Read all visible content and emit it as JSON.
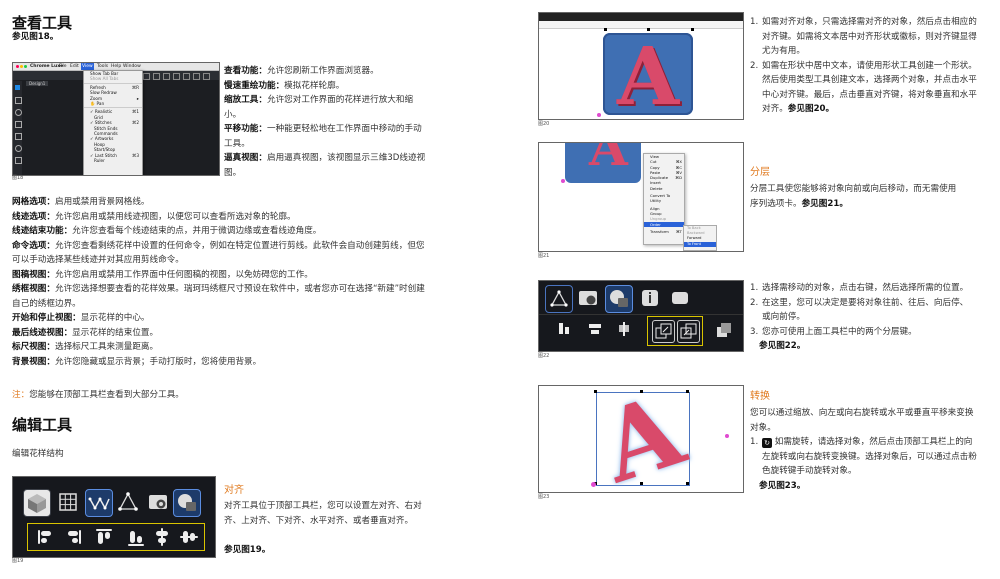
{
  "left": {
    "title_view": "查看工具",
    "see18": "参见图18。",
    "fig18": {
      "app_name": "Chrome Luxe",
      "menus": [
        "File",
        "Edit",
        "View",
        "Tools",
        "Help",
        "Window"
      ],
      "menu_items": [
        "Show Tab Bar",
        "Show All Tabs",
        "Refresh",
        "Slow Redraw",
        "Zoom",
        "Pan",
        "Realistic",
        "Grid",
        "Stitches",
        "Stitch Ends",
        "Commands",
        "Artworks",
        "Hoop",
        "Start/Stop",
        "Last Stitch",
        "Ruler"
      ],
      "shortcuts": [
        "⌘R",
        "⌘1",
        "⌘2",
        "⌘3"
      ],
      "design_tab": "Design1",
      "label": "图18"
    },
    "desc_top": [
      {
        "term": "查看功能：",
        "text": "允许您刷新工作界面浏览器。"
      },
      {
        "term": "慢速重绘功能：",
        "text": "模拟花样轮廓。"
      },
      {
        "term": "缩放工具：",
        "text": "允许您对工作界面的花样进行放大和缩小。"
      },
      {
        "term": "平移功能：",
        "text": "一种能更轻松地在工作界面中移动的手动工具。"
      },
      {
        "term": "逼真视图：",
        "text": "启用逼真视图，该视图显示三维3D线迹视图。"
      }
    ],
    "desc_list": [
      {
        "term": "网格选项：",
        "text": "启用或禁用背景网格线。"
      },
      {
        "term": "线迹选项：",
        "text": "允许您启用或禁用线迹视图，以便您可以查看所选对象的轮廓。"
      },
      {
        "term": "线迹结束功能：",
        "text": "允许您查看每个线迹结束的点，并用于微调边缘或查看线迹角度。"
      },
      {
        "term": "命令选项：",
        "text": "允许您查看剩绣花样中设置的任何命令，例如在特定位置进行剪线。此软件会自动创建剪线，但您可以手动选择某些线迹并对其应用剪线命令。"
      },
      {
        "term": "图稿视图：",
        "text": "允许您启用或禁用工作界面中任何图稿的视图，以免妨碍您的工作。"
      },
      {
        "term": "绣框视图：",
        "text": "允许您选择想要查看的花样效果。瑞珂玛绣框尺寸预设在软件中，或者您亦可在选择“新建”时创建自己的绣框边界。"
      },
      {
        "term": "开始和停止视图：",
        "text": "显示花样的中心。"
      },
      {
        "term": "最后线迹视图：",
        "text": "显示花样的结束位置。"
      },
      {
        "term": "标尺视图：",
        "text": "选择标尺工具来测量距离。"
      },
      {
        "term": "背景视图：",
        "text": "允许您隐藏或显示背景；手动打版时，您将使用背景。"
      }
    ],
    "note_label": "注：",
    "note_text": "您能够在顶部工具栏查看到大部分工具。",
    "title_edit": "编辑工具",
    "edit_sub": "编辑花样结构",
    "fig19": {
      "label": "图19"
    },
    "align_title": "对齐",
    "align_text": "对齐工具位于顶部工具栏，您可以设置左对齐、右对齐、上对齐、下对齐、水平对齐、或者垂直对齐。",
    "see19": "参见图19。"
  },
  "right": {
    "fig20": {
      "label": "图20",
      "letter": "A"
    },
    "align_steps": [
      "如需对齐对象，只需选择需对齐的对象，然后点击相应的对齐键。如需将文本居中对齐形状或徽标，则对齐键显得尤为有用。",
      "如需在形状中居中文本，请使用形状工具创建一个形状。然后使用类型工具创建文本，选择两个对象，并点击水平中心对齐键。最后，点击垂直对齐键，将对象垂直和水平对齐。"
    ],
    "see20": "参见图20。",
    "fig21": {
      "label": "图21",
      "menu_items": [
        "View",
        "Cut",
        "Copy",
        "Paste",
        "Duplicate",
        "Insert",
        "Delete",
        "Convert To",
        "Utility",
        "Align",
        "Group",
        "Ungroup",
        "Order",
        "Transform"
      ],
      "shortcuts": [
        "⌘X",
        "⌘C",
        "⌘V",
        "⌘D",
        "⌘T"
      ],
      "sub_items": [
        "To Back",
        "Backward",
        "Forward",
        "To Front"
      ]
    },
    "layer_title": "分层",
    "layer_text": "分层工具使您能够将对象向前或向后移动，而无需使用序列选项卡。",
    "see21": "参见图21。",
    "fig22": {
      "label": "图22"
    },
    "layer_steps": [
      "选择需移动的对象，点击右键，然后选择所需的位置。",
      "在这里，您可以决定是要将对象往前、往后、向后停、或向前停。",
      "您亦可使用上面工具栏中的两个分层键。"
    ],
    "see22": "参见图22。",
    "fig23": {
      "label": "图23",
      "letter": "A"
    },
    "rotate_title": "转换",
    "rotate_text": "您可以通过缩放、向左或向右旋转或水平或垂直平移来变换对象。",
    "rotate_step": "如需旋转，请选择对象，然后点击顶部工具栏上的向左旋转或向右旋转变换键。选择对象后，可以通过点击粉色旋转键手动旋转对象。",
    "see23": "参见图23。"
  }
}
